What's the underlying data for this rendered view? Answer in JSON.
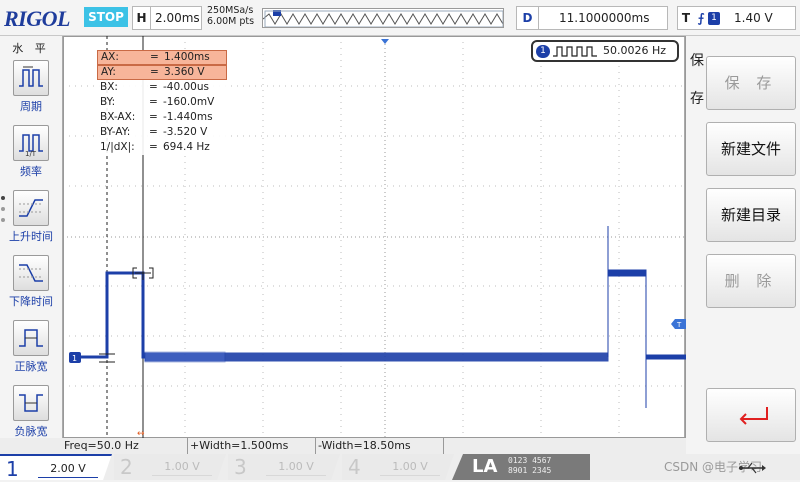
{
  "top": {
    "logo": "RIGOL",
    "run_state": "STOP",
    "timebase_key": "H",
    "timebase": "2.00ms",
    "sample_rate": "250MSa/s",
    "memory_depth": "6.00M pts",
    "delay_key": "D",
    "delay": "11.1000000ms",
    "trigger_key": "T",
    "trigger_channel": "1",
    "trigger_level": "1.40 V"
  },
  "left_menu": {
    "title": "水 平",
    "items": [
      {
        "label": "周期",
        "icon": "period-icon"
      },
      {
        "label": "频率",
        "icon": "frequency-icon"
      },
      {
        "label": "上升时间",
        "icon": "rise-time-icon"
      },
      {
        "label": "下降时间",
        "icon": "fall-time-icon"
      },
      {
        "label": "正脉宽",
        "icon": "positive-pulse-width-icon"
      },
      {
        "label": "负脉宽",
        "icon": "negative-pulse-width-icon"
      }
    ]
  },
  "cursor": {
    "rows": [
      {
        "name": "AX:",
        "value": "1.400ms",
        "highlight": true
      },
      {
        "name": "AY:",
        "value": "3.360 V",
        "highlight": true
      },
      {
        "name": "BX:",
        "value": "-40.00us",
        "highlight": false
      },
      {
        "name": "BY:",
        "value": "-160.0mV",
        "highlight": false
      },
      {
        "name": "BX-AX:",
        "value": "-1.440ms",
        "highlight": false
      },
      {
        "name": "BY-AY:",
        "value": "-3.520 V",
        "highlight": false
      },
      {
        "name": "1/|dX|:",
        "value": "694.4 Hz",
        "highlight": false
      }
    ],
    "eq": "="
  },
  "freq_counter": {
    "channel": "1",
    "value": "50.0026 Hz"
  },
  "measurements": [
    {
      "label": "Freq=50.0 Hz"
    },
    {
      "label": "+Width=1.500ms"
    },
    {
      "label": "-Width=18.50ms"
    }
  ],
  "right_menu": {
    "title_top": "保",
    "title_bottom": "存",
    "buttons": [
      {
        "label": "保 存",
        "enabled": false
      },
      {
        "label": "新建文件",
        "enabled": true
      },
      {
        "label": "新建目录",
        "enabled": true
      },
      {
        "label": "删 除",
        "enabled": false
      }
    ]
  },
  "channels": [
    {
      "num": "1",
      "volt": "2.00 V",
      "active": true
    },
    {
      "num": "2",
      "volt": "1.00 V",
      "active": false
    },
    {
      "num": "3",
      "volt": "1.00 V",
      "active": false
    },
    {
      "num": "4",
      "volt": "1.00 V",
      "active": false
    }
  ],
  "la": {
    "label": "LA",
    "bits_top": "0123 4567",
    "bits_bottom": "8901 2345"
  },
  "watermark": "CSDN @电子学习",
  "colors": {
    "channel1": "#1c3fa8",
    "stop": "#3cc2e6",
    "cursor_highlight": "#f7b59a"
  }
}
